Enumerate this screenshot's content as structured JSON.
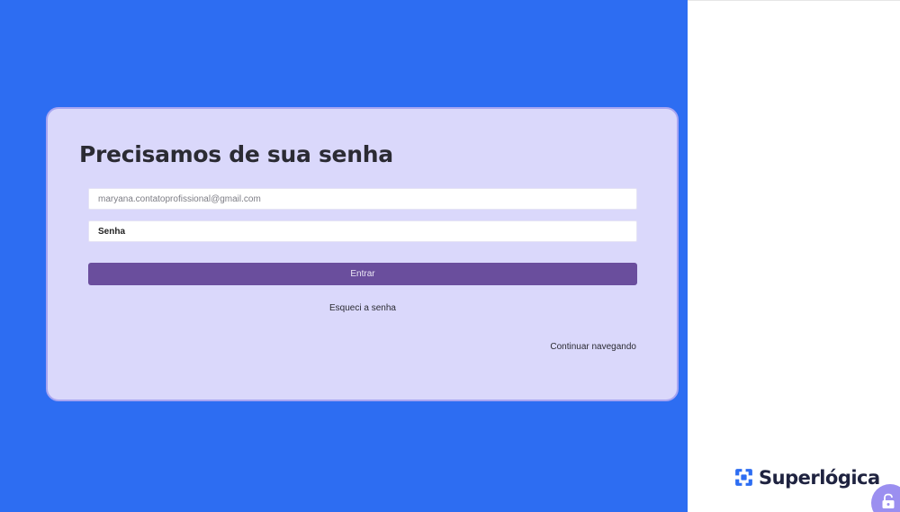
{
  "login": {
    "title": "Precisamos de sua senha",
    "email_value": "maryana.contatoprofissional@gmail.com",
    "password_placeholder": "Senha",
    "submit_label": "Entrar",
    "forgot_label": "Esqueci a senha",
    "continue_label": "Continuar navegando"
  },
  "brand": {
    "name": "Superlógica",
    "icon": "superlogica-logo-icon"
  },
  "widget": {
    "icon": "unlock-icon"
  },
  "colors": {
    "background_left": "#2d6df2",
    "card_background": "#dad8fb",
    "button_primary": "#6a4e9d",
    "brand_blue": "#2d6df2",
    "widget": "#9b8ff0"
  }
}
